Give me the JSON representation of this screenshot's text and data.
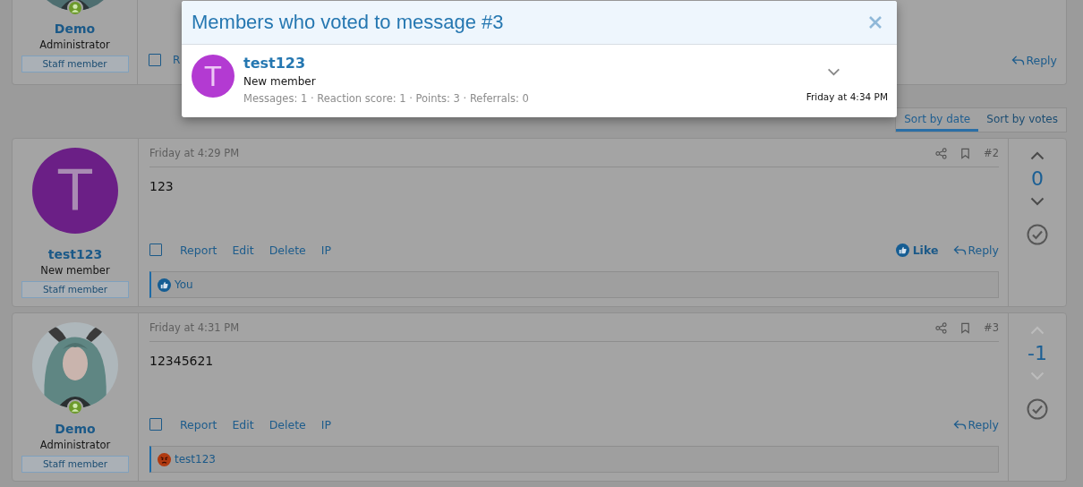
{
  "clipped_post": {
    "author": {
      "name": "Demo",
      "role": "Administrator",
      "badge": "Staff member",
      "online": true
    },
    "checked": false,
    "actions": [
      "R"
    ],
    "reply": "Reply"
  },
  "modal": {
    "title": "Members who voted to message #3",
    "voters": [
      {
        "initial": "T",
        "name": "test123",
        "role": "New member",
        "stats": "Messages: 1 · Reaction score: 1 · Points: 3 · Referrals: 0",
        "time": "Friday at 4:34 PM"
      }
    ]
  },
  "sort_tabs": [
    {
      "label": "Sort by date",
      "selected": true
    },
    {
      "label": "Sort by votes",
      "selected": false
    }
  ],
  "posts": [
    {
      "author": {
        "avatar": {
          "kind": "letter",
          "letter": "T",
          "color": "#6b1f86"
        },
        "name": "test123",
        "role": "New member",
        "badge": "Staff member",
        "online": false
      },
      "date": "Friday at 4:29 PM",
      "number": "#2",
      "body": "123",
      "checked": false,
      "actions": [
        "Report",
        "Edit",
        "Delete",
        "IP"
      ],
      "like": "Like",
      "reply": "Reply",
      "reaction": {
        "kind": "like",
        "users": "You"
      },
      "votes": {
        "score": "0",
        "arrows_enabled": true
      }
    },
    {
      "author": {
        "name": "Demo",
        "role": "Administrator",
        "badge": "Staff member",
        "online": true
      },
      "date": "Friday at 4:31 PM",
      "number": "#3",
      "body": "12345621",
      "checked": false,
      "actions": [
        "Report",
        "Edit",
        "Delete",
        "IP"
      ],
      "reply": "Reply",
      "reaction": {
        "kind": "angry",
        "users": "test123"
      },
      "votes": {
        "score": "-1",
        "arrows_enabled": false
      }
    }
  ]
}
